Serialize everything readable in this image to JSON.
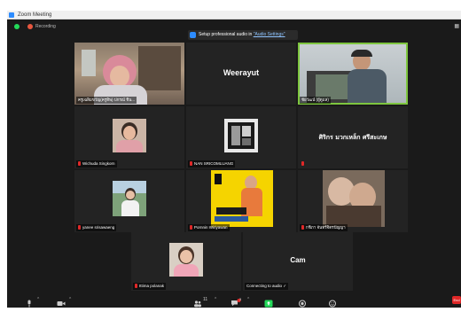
{
  "window": {
    "title": "Zoom Meeting"
  },
  "status": {
    "recording_label": "Recording"
  },
  "banner": {
    "prefix": "Setup professional audio in ",
    "link": "\"Audio Settings\""
  },
  "tiles": [
    {
      "name": "ครูเฉลิมขวัญ(ครูทิพ) ปกรณ์ ชิน..."
    },
    {
      "name": "",
      "display": "Weerayut"
    },
    {
      "name": "ชัยวัฒน์ (ผู้ดูแล)"
    },
    {
      "name": "Wichuda Singkorn"
    },
    {
      "name": "NAN SRICOMLUANG"
    },
    {
      "name": "",
      "display": "ศิริกร มวกเหล็ก ศรีสะเกษ"
    },
    {
      "name": "yanee srisawaeng"
    },
    {
      "name": "Pornnin Wiriyawan"
    },
    {
      "name": "กชิภา จันทร์จิตรปัญญา"
    },
    {
      "name": "Ittima polanak"
    },
    {
      "name": "Connecting to audio",
      "display": "Cam"
    }
  ],
  "toolbar": {
    "participants_count": "11",
    "chat_badge": "3",
    "end_label": "End"
  },
  "colors": {
    "active_speaker": "#7ec63f",
    "muted": "#e02828",
    "zoom_blue": "#2d8cff",
    "share_green": "#23d959"
  }
}
